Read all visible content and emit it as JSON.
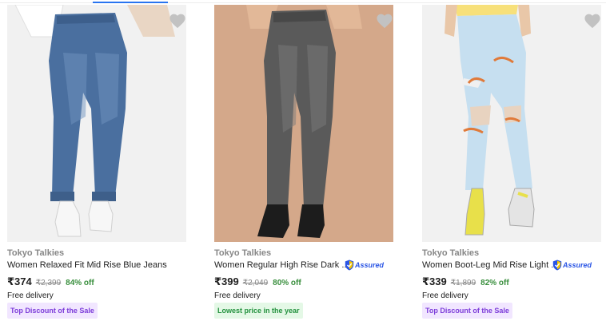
{
  "products": [
    {
      "brand": "Tokyo Talkies",
      "title": "Women Relaxed Fit Mid Rise Blue Jeans",
      "price": "₹374",
      "mrp": "₹2,399",
      "discount": "84% off",
      "delivery": "Free delivery",
      "tag": "Top Discount of the Sale",
      "assured": ""
    },
    {
      "brand": "Tokyo Talkies",
      "title": "Women Regular High Rise Dark ...",
      "price": "₹399",
      "mrp": "₹2,049",
      "discount": "80% off",
      "delivery": "Free delivery",
      "tag": "Lowest price in the year",
      "assured": "Assured"
    },
    {
      "brand": "Tokyo Talkies",
      "title": "Women Boot-Leg Mid Rise Light ...",
      "price": "₹339",
      "mrp": "₹1,899",
      "discount": "82% off",
      "delivery": "Free delivery",
      "tag": "Top Discount of the Sale",
      "assured": "Assured"
    }
  ],
  "colors": {
    "accent": "#2874f0",
    "discount": "#388e3c",
    "tag_purple_bg": "#f1e6ff",
    "tag_purple_fg": "#7c3cd9",
    "tag_green_bg": "#e4f8e6",
    "tag_green_fg": "#23913e",
    "assured": "#2a55e5"
  },
  "icons": {
    "wishlist": "heart-icon",
    "assured": "shield-check-icon"
  }
}
